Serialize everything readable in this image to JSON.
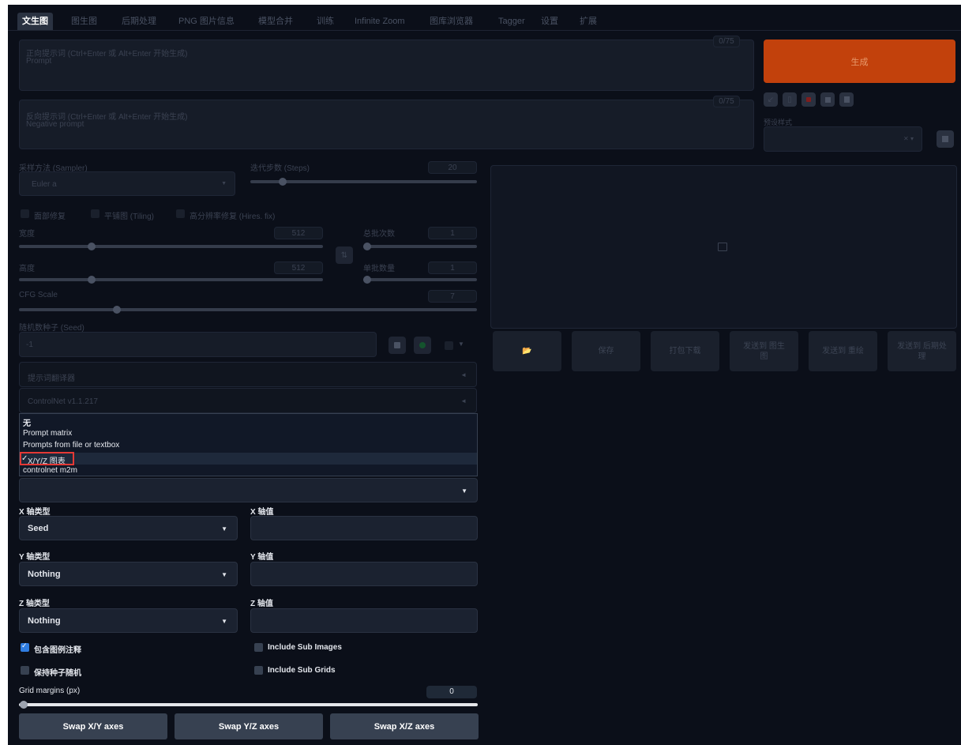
{
  "tabs": [
    "文生图",
    "图生图",
    "后期处理",
    "PNG 图片信息",
    "模型合并",
    "训练",
    "Infinite Zoom",
    "图库浏览器",
    "Tagger",
    "设置",
    "扩展"
  ],
  "prompt": {
    "placeholder": "正向提示词 (Ctrl+Enter 或 Alt+Enter 开始生成)",
    "placeholder_en": "Prompt",
    "counter": "0/75"
  },
  "negative_prompt": {
    "placeholder": "反向提示词 (Ctrl+Enter 或 Alt+Enter 开始生成)",
    "placeholder_en": "Negative prompt",
    "counter": "0/75"
  },
  "generate_label": "生成",
  "preset": {
    "label": "预设样式",
    "clear": "✕ ▾"
  },
  "sampler": {
    "label": "采样方法 (Sampler)",
    "value": "Euler a"
  },
  "steps": {
    "label": "迭代步数 (Steps)",
    "value": "20",
    "fraction": 0.2
  },
  "options": [
    "面部修复",
    "平铺图 (Tiling)",
    "高分辨率修复 (Hires. fix)"
  ],
  "width": {
    "label": "宽度",
    "value": "512",
    "fraction": 0.24
  },
  "height": {
    "label": "高度",
    "value": "512",
    "fraction": 0.24
  },
  "batch_count": {
    "label": "总批次数",
    "value": "1",
    "fraction": 0.0
  },
  "batch_size": {
    "label": "单批数量",
    "value": "1",
    "fraction": 0.0
  },
  "swap_wh_icon": "⇅",
  "cfg": {
    "label": "CFG Scale",
    "value": "7",
    "fraction": 0.21
  },
  "seed": {
    "label": "随机数种子 (Seed)",
    "value": "-1"
  },
  "accordions": [
    {
      "label": "提示词翻译器",
      "arrow": "◄"
    },
    {
      "label": "ControlNet v1.1.217",
      "arrow": "◄"
    }
  ],
  "script_menu": {
    "items": [
      "无",
      "Prompt matrix",
      "Prompts from file or textbox",
      "X/Y/Z 图表",
      "controlnet m2m"
    ],
    "selected_index": 3,
    "check": "✓"
  },
  "x_axis": {
    "type_label": "X 轴类型",
    "type_value": "Seed",
    "value_label": "X 轴值"
  },
  "y_axis": {
    "type_label": "Y 轴类型",
    "type_value": "Nothing",
    "value_label": "Y 轴值"
  },
  "z_axis": {
    "type_label": "Z 轴类型",
    "type_value": "Nothing",
    "value_label": "Z 轴值"
  },
  "checkboxes": [
    {
      "label": "包含图例注释",
      "checked": true
    },
    {
      "label": "保持种子随机",
      "checked": false
    },
    {
      "label": "Include Sub Images",
      "checked": false
    },
    {
      "label": "Include Sub Grids",
      "checked": false
    }
  ],
  "grid_margins": {
    "label": "Grid margins (px)",
    "value": "0",
    "fraction": 0.0
  },
  "swap_buttons": [
    "Swap X/Y axes",
    "Swap Y/Z axes",
    "Swap X/Z axes"
  ],
  "output_buttons": [
    "📂",
    "保存",
    "打包下载",
    "发送到 图生图",
    "发送到 重绘",
    "发送到 后期处理"
  ],
  "colors": {
    "background": "#0b0f19",
    "generate": "#c2410c",
    "accent": "#2f7de1",
    "highlight_box": "#e53935"
  }
}
